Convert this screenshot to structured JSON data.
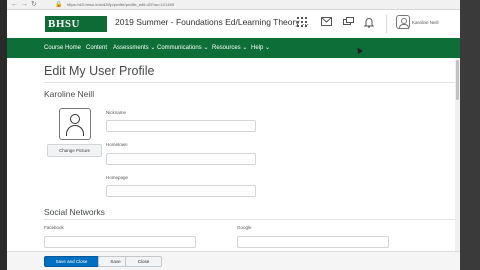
{
  "browser": {
    "url": "https://d2l.bhsu.edu/d2l/lp/profile/profile_edit.d2l?ou=121489"
  },
  "header": {
    "logo_text": "BHSU",
    "course_title": "2019 Summer - Foundations Ed/Learning Theory ...",
    "user_name": "Karoline Neill",
    "icons": [
      "grid-icon",
      "mail-icon",
      "chat-icon",
      "bell-icon"
    ]
  },
  "nav": {
    "items": [
      {
        "label": "Course Home"
      },
      {
        "label": "Content"
      },
      {
        "label": "Assessments ⌄"
      },
      {
        "label": "Communications ⌄"
      },
      {
        "label": "Resources ⌄"
      },
      {
        "label": "Help ⌄"
      }
    ]
  },
  "page": {
    "title": "Edit My User Profile",
    "person_name": "Karoline Neill",
    "change_picture_label": "Change Picture",
    "fields": {
      "nickname_label": "Nickname",
      "hometown_label": "Hometown",
      "homepage_label": "Homepage",
      "nickname_value": "",
      "hometown_value": "",
      "homepage_value": ""
    },
    "social": {
      "title": "Social Networks",
      "facebook_label": "Facebook",
      "google_label": "Google"
    }
  },
  "buttons": {
    "save_close": "Save and Close",
    "save": "Save",
    "close": "Close"
  },
  "colors": {
    "brand_green": "#0d6f37",
    "primary_blue": "#006fbf"
  }
}
